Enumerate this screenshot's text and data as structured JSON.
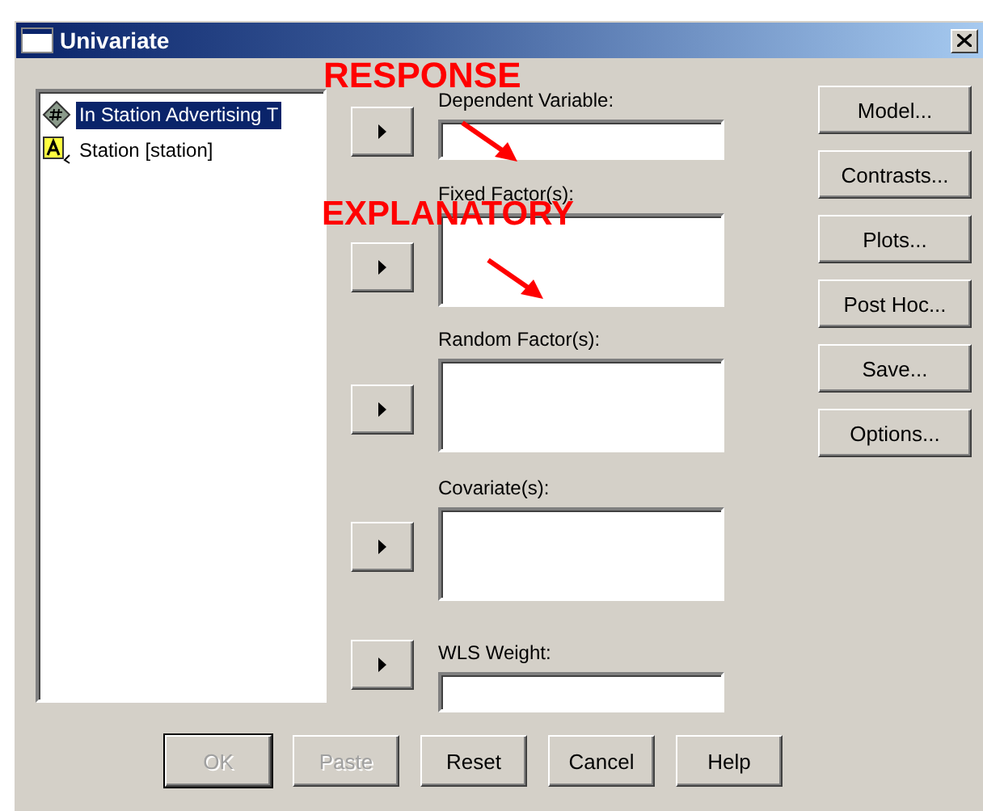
{
  "window": {
    "title": "Univariate"
  },
  "variables": [
    {
      "name": "In Station Advertising T",
      "kind": "numeric",
      "selected": true
    },
    {
      "name": "Station [station]",
      "kind": "string",
      "selected": false
    }
  ],
  "targets": [
    {
      "label": "Dependent Variable:",
      "kind": "single"
    },
    {
      "label": "Fixed Factor(s):",
      "kind": "list"
    },
    {
      "label": "Random Factor(s):",
      "kind": "list"
    },
    {
      "label": "Covariate(s):",
      "kind": "list"
    },
    {
      "label": "WLS Weight:",
      "kind": "single"
    }
  ],
  "side_buttons": [
    "Model...",
    "Contrasts...",
    "Plots...",
    "Post Hoc...",
    "Save...",
    "Options..."
  ],
  "bottom_buttons": [
    {
      "label": "OK",
      "disabled": true,
      "default": true
    },
    {
      "label": "Paste",
      "disabled": true,
      "default": false
    },
    {
      "label": "Reset",
      "disabled": false,
      "default": false
    },
    {
      "label": "Cancel",
      "disabled": false,
      "default": false
    },
    {
      "label": "Help",
      "disabled": false,
      "default": false
    }
  ],
  "annotations": [
    {
      "text": "RESPONSE"
    },
    {
      "text": "EXPLANATORY"
    }
  ]
}
